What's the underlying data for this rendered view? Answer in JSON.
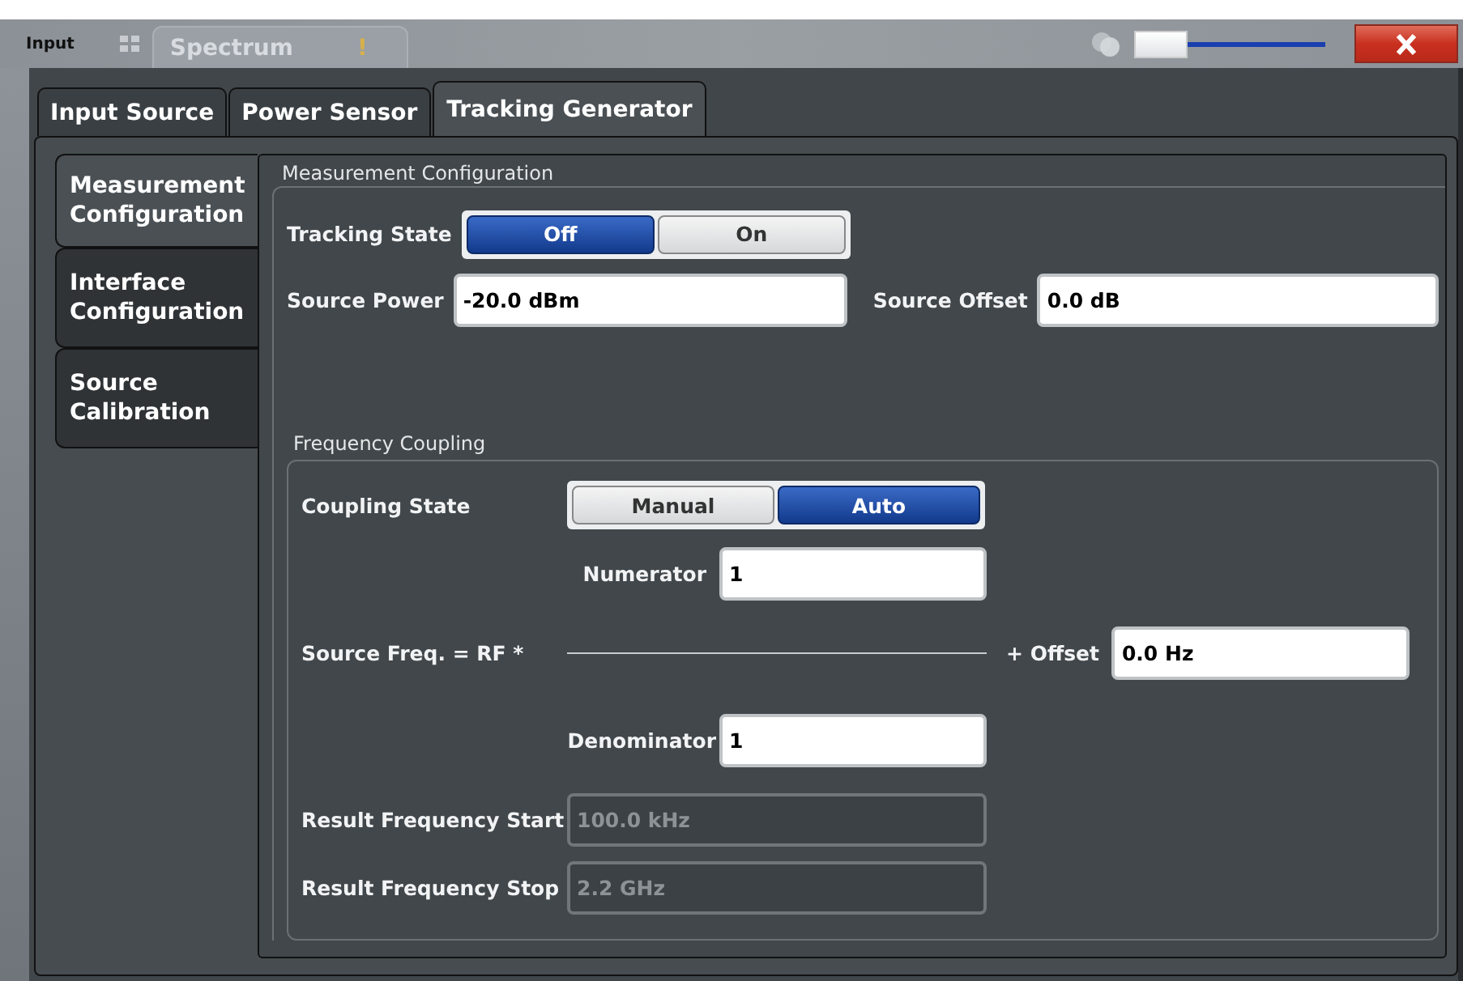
{
  "window": {
    "title": "Input",
    "app_tab": "Spectrum",
    "app_tab_warning": "!",
    "slider": {
      "level": 0.0
    }
  },
  "tabs": [
    {
      "label": "Input Source",
      "selected": false
    },
    {
      "label": "Power Sensor",
      "selected": false
    },
    {
      "label": "Tracking Generator",
      "selected": true
    }
  ],
  "side_tabs": [
    {
      "label": "Measurement Configuration",
      "selected": true
    },
    {
      "label": "Interface Configuration",
      "selected": false
    },
    {
      "label": "Source Calibration",
      "selected": false
    }
  ],
  "measurement": {
    "title": "Measurement Configuration",
    "tracking_state": {
      "label": "Tracking State",
      "options": [
        {
          "label": "Off",
          "selected": true
        },
        {
          "label": "On",
          "selected": false
        }
      ]
    },
    "source_power": {
      "label": "Source Power",
      "value": "-20.0 dBm"
    },
    "source_offset": {
      "label": "Source Offset",
      "value": "0.0 dB"
    }
  },
  "coupling": {
    "title": "Frequency Coupling",
    "coupling_state": {
      "label": "Coupling State",
      "options": [
        {
          "label": "Manual",
          "selected": false
        },
        {
          "label": "Auto",
          "selected": true
        }
      ]
    },
    "numerator": {
      "label": "Numerator",
      "value": "1"
    },
    "formula_label": "Source Freq. = RF *",
    "offset": {
      "label": "+ Offset",
      "value": "0.0 Hz"
    },
    "denominator": {
      "label": "Denominator",
      "value": "1"
    },
    "result_start": {
      "label": "Result Frequency Start",
      "value": "100.0 kHz",
      "disabled": true
    },
    "result_stop": {
      "label": "Result Frequency Stop",
      "value": "2.2 GHz",
      "disabled": true
    }
  }
}
